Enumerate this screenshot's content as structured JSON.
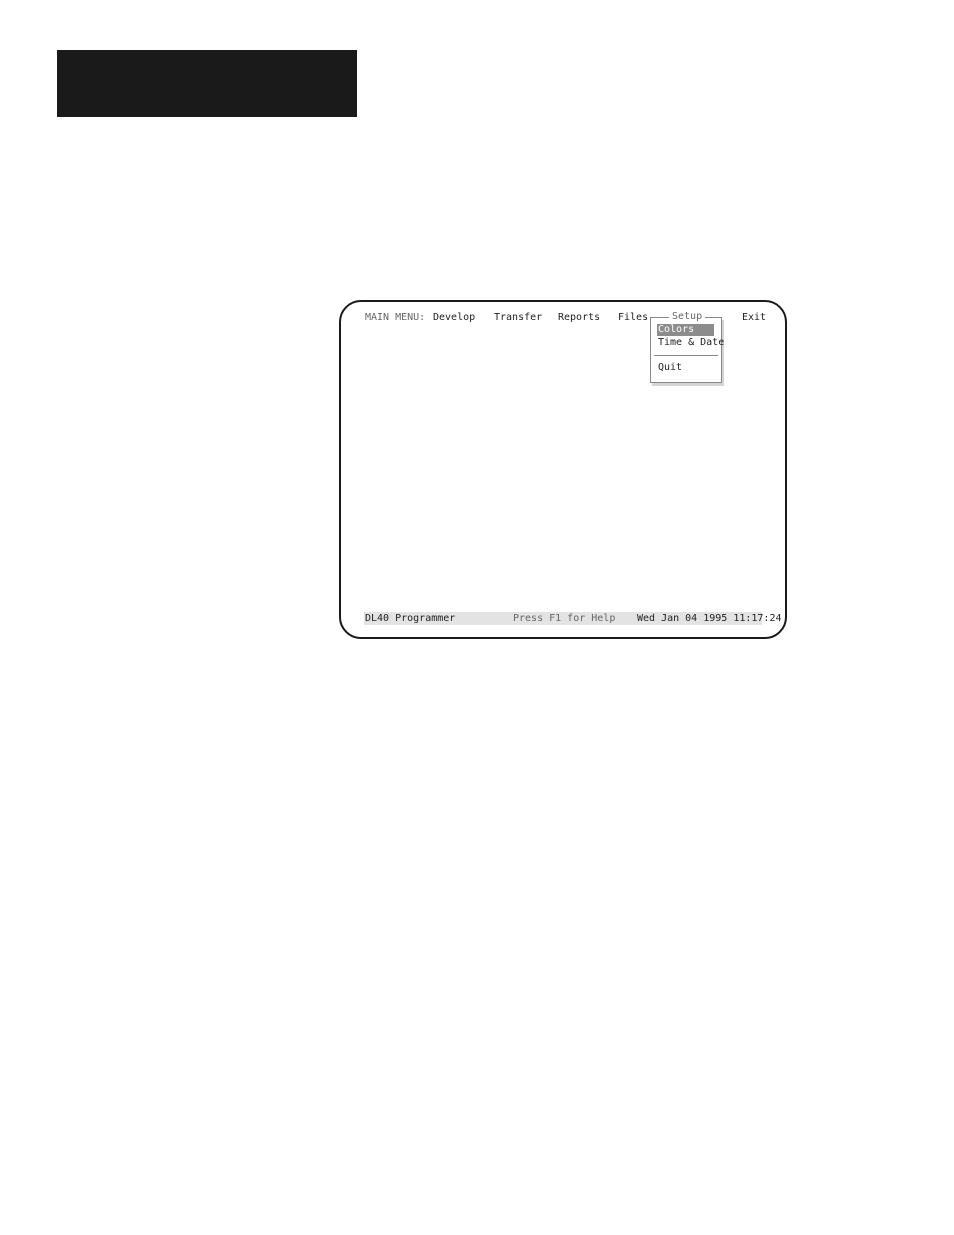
{
  "menubar": {
    "label": "MAIN MENU:",
    "items": [
      "Develop",
      "Transfer",
      "Reports",
      "Files",
      "Setup",
      "Exit"
    ]
  },
  "setup_menu": {
    "title": "Setup",
    "items": [
      "Colors",
      "Time & Date",
      "Quit"
    ],
    "selected": "Colors"
  },
  "statusbar": {
    "app_name": "DL40 Programmer",
    "help_text": "Press F1 for Help",
    "datetime": "Wed Jan 04 1995 11:17:24"
  },
  "colors": {
    "highlight": "#8c8c8c",
    "statusbar_bg": "#e3e3e3",
    "header_block": "#1a1a1a"
  }
}
